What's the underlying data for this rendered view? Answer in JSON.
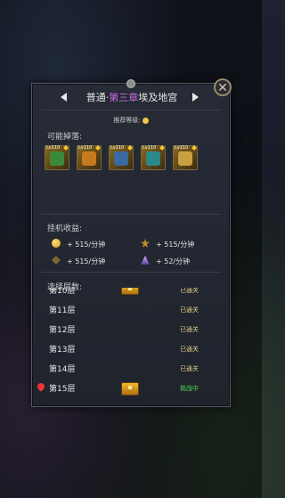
{
  "header": {
    "difficulty": "普通",
    "separator": "·",
    "chapter": "第三章",
    "stage_name": "埃及地宫",
    "recommended_label": "推荐等级:"
  },
  "drops": {
    "label": "可能掉落:",
    "items": [
      {
        "level": "Lv110",
        "icon": "green-weapon-icon",
        "color": "#3a8a3a"
      },
      {
        "level": "Lv110",
        "icon": "orange-armor-icon",
        "color": "#c87a20"
      },
      {
        "level": "Lv110",
        "icon": "blue-helmet-icon",
        "color": "#3a6aa0"
      },
      {
        "level": "Lv110",
        "icon": "teal-boots-icon",
        "color": "#2a8a8a"
      },
      {
        "level": "Lv110",
        "icon": "gold-sword-icon",
        "color": "#c8a040"
      }
    ]
  },
  "income": {
    "label": "挂机收益:",
    "gold": "+ 515/分钟",
    "exp": "+ 515/分钟",
    "star": "+ 515/分钟",
    "crystal": "+ 52/分钟"
  },
  "floors": {
    "label": "选择层数:",
    "list": [
      {
        "name": "第10层",
        "status": "已通关"
      },
      {
        "name": "第11层",
        "status": "已通关"
      },
      {
        "name": "第12层",
        "status": "已通关"
      },
      {
        "name": "第13层",
        "status": "已通关"
      },
      {
        "name": "第14层",
        "status": "已通关"
      },
      {
        "name": "第15层",
        "status": "挑战中"
      }
    ]
  },
  "colors": {
    "chapter": "#c46be0",
    "active_status": "#4fdc4f",
    "cleared_status": "#e0d08a"
  }
}
